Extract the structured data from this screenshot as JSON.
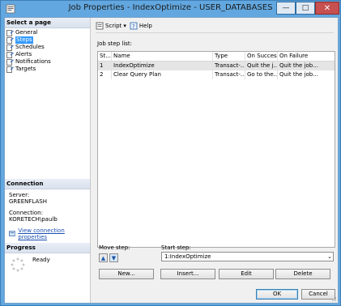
{
  "window": {
    "title": "Job Properties - IndexOptimize - USER_DATABASES"
  },
  "colors": {
    "accent": "#3399ff",
    "close": "#c75050",
    "link": "#1a4fb0"
  },
  "sidebar": {
    "header": "Select a page",
    "items": [
      {
        "label": "General",
        "icon": "page-icon",
        "selected": false
      },
      {
        "label": "Steps",
        "icon": "page-icon",
        "selected": true
      },
      {
        "label": "Schedules",
        "icon": "page-icon",
        "selected": false
      },
      {
        "label": "Alerts",
        "icon": "page-icon",
        "selected": false
      },
      {
        "label": "Notifications",
        "icon": "page-icon",
        "selected": false
      },
      {
        "label": "Targets",
        "icon": "page-icon",
        "selected": false
      }
    ]
  },
  "connection": {
    "header": "Connection",
    "server_label": "Server:",
    "server_value": "GREENFLASH",
    "conn_label": "Connection:",
    "conn_value": "KORETECH\\paulb",
    "link_label": "View connection properties"
  },
  "progress": {
    "header": "Progress",
    "status": "Ready"
  },
  "toolbar": {
    "script_label": "Script",
    "help_label": "Help"
  },
  "steps": {
    "list_label": "Job step list:",
    "columns": [
      "St...",
      "Name",
      "Type",
      "On Success",
      "On Failure"
    ],
    "rows": [
      [
        "1",
        "IndexOptimize",
        "Transact-...",
        "Quit the j...",
        "Quit the job..."
      ],
      [
        "2",
        "Clear Query Plan",
        "Transact-...",
        "Go to the...",
        "Quit the job..."
      ]
    ],
    "move_label": "Move step:",
    "start_label": "Start step:",
    "start_value": "1:IndexOptimize"
  },
  "buttons": {
    "new": "New...",
    "insert": "Insert...",
    "edit": "Edit",
    "delete": "Delete",
    "ok": "OK",
    "cancel": "Cancel"
  }
}
